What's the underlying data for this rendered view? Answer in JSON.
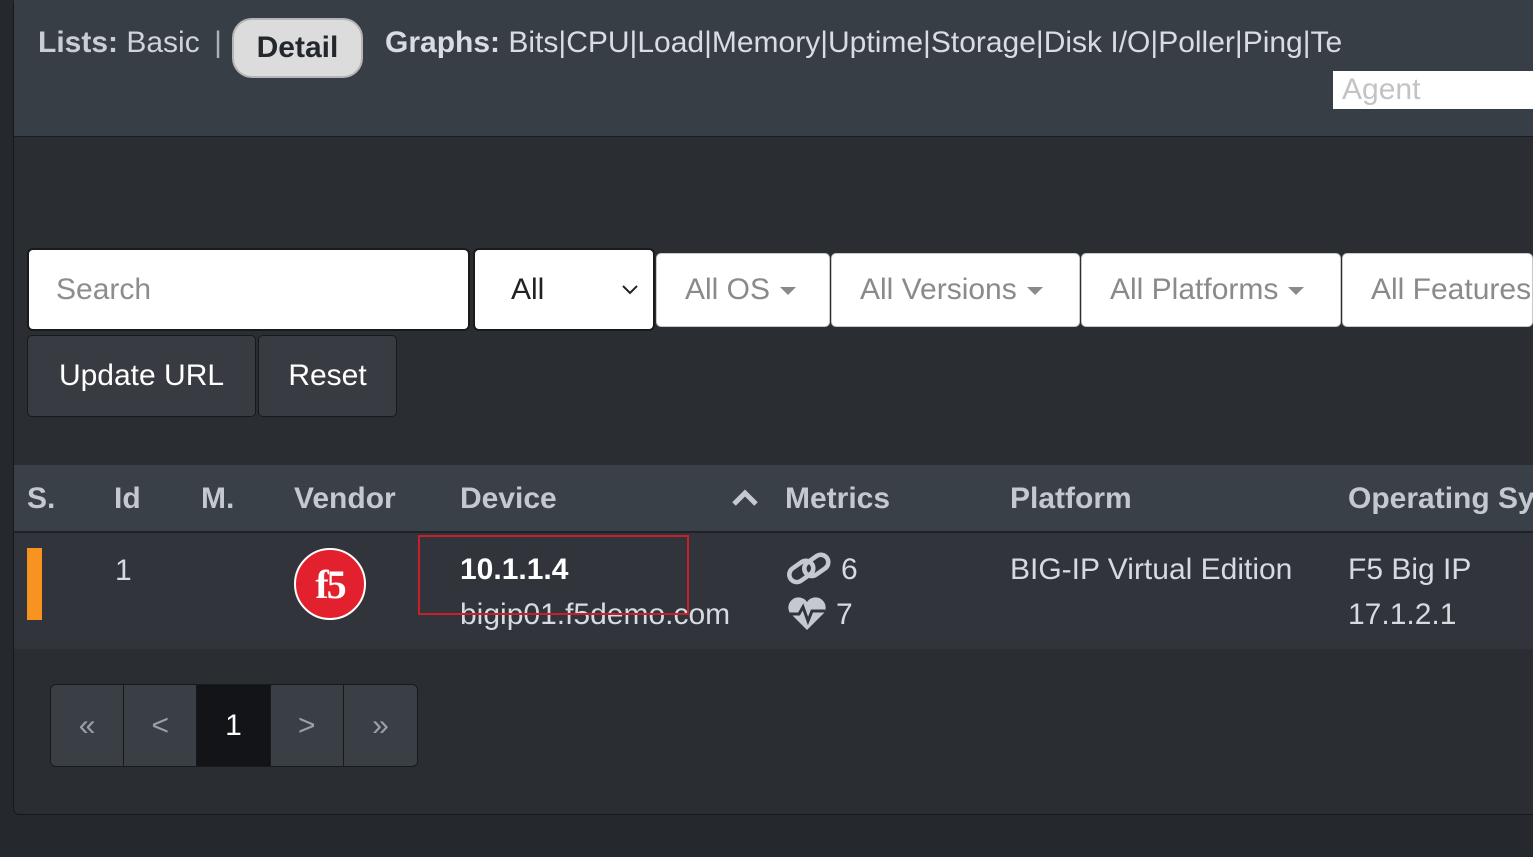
{
  "nav": {
    "lists_label": "Lists:",
    "lists_basic": "Basic",
    "lists_detail": "Detail",
    "separator": "|",
    "graphs_label": "Graphs:",
    "graphs_items": [
      "Bits",
      "CPU",
      "Load",
      "Memory",
      "Uptime",
      "Storage",
      "Disk I/O",
      "Poller",
      "Ping",
      "Te"
    ],
    "agent_placeholder": "Agent"
  },
  "filters": {
    "search_placeholder": "Search",
    "select_value": "All",
    "os": "All OS",
    "versions": "All Versions",
    "platforms": "All Platforms",
    "features": "All Features",
    "update_url": "Update URL",
    "reset": "Reset"
  },
  "table": {
    "headers": [
      "S.",
      "Id",
      "M.",
      "Vendor",
      "Device",
      "Metrics",
      "Platform",
      "Operating Sy"
    ],
    "rows": [
      {
        "status_color": "#f7931e",
        "id": "1",
        "vendor_logo": "f5",
        "device_ip": "10.1.1.4",
        "device_host": "bigip01.f5demo.com",
        "metric_ports": "6",
        "metric_sensors": "7",
        "platform": "BIG-IP Virtual Edition",
        "os_name": "F5 Big IP",
        "os_version": "17.1.2.1"
      }
    ]
  },
  "pagination": {
    "first": "«",
    "prev": "<",
    "current": "1",
    "next": ">",
    "last": "»"
  },
  "colors": {
    "highlight_box": "#c8202a",
    "status_warning": "#f7931e",
    "vendor_red": "#e2202e"
  },
  "icons": {
    "sort": "chevron-up-icon",
    "ports": "link-icon",
    "sensors": "heartbeat-icon"
  }
}
